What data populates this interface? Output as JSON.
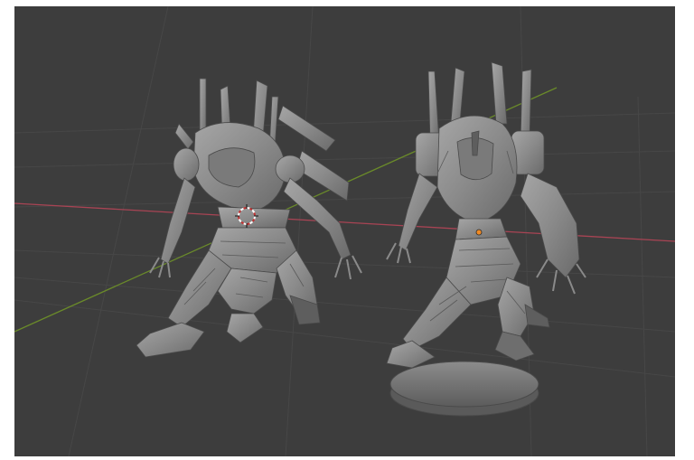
{
  "viewport": {
    "background": "#3d3d3d",
    "grid_color": "#474747",
    "x_axis_color": "#a84454",
    "y_axis_color": "#6a8a2a",
    "model_color": "#8e8e8e",
    "origin_color": "#f08a24"
  },
  "objects": [
    {
      "name": "mech-model-left"
    },
    {
      "name": "mech-model-right-with-base"
    }
  ],
  "icons": {
    "cursor": "3d-cursor-icon",
    "origin": "object-origin-dot"
  }
}
